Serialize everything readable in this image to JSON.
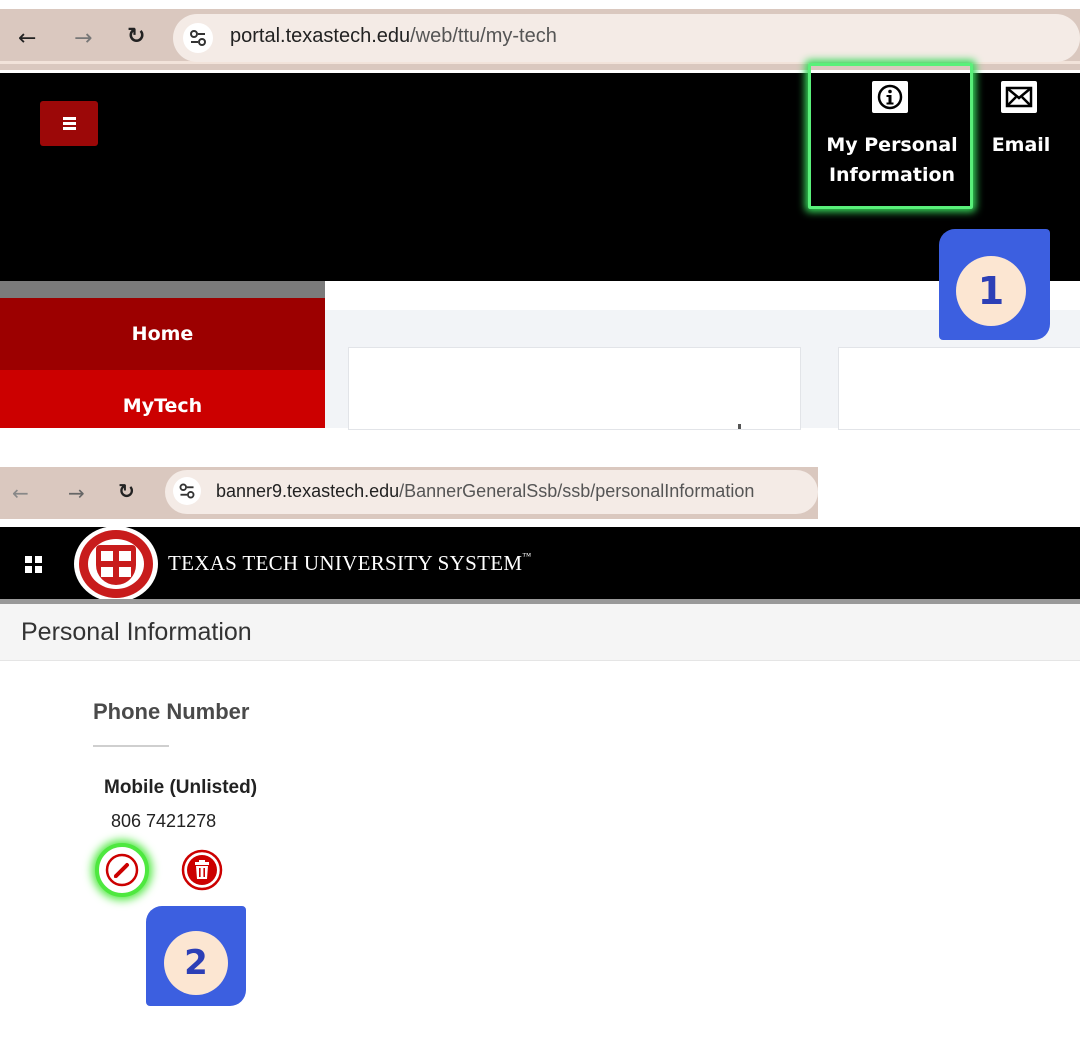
{
  "top_screenshot": {
    "browser": {
      "url_host": "portal.texastech.edu",
      "url_path": "/web/ttu/my-tech"
    },
    "header": {
      "personal_info_label_line1": "My Personal",
      "personal_info_label_line2": "Information",
      "email_label": "Email"
    },
    "sidebar": {
      "items": [
        {
          "label": "Home"
        },
        {
          "label": "MyTech"
        }
      ]
    },
    "step_badge": "1"
  },
  "bottom_screenshot": {
    "browser": {
      "url_host": "banner9.texastech.edu",
      "url_path": "/BannerGeneralSsb/ssb/personalInformation"
    },
    "header": {
      "system_name": "TEXAS TECH UNIVERSITY SYSTEM",
      "trademark": "™"
    },
    "page_title": "Personal Information",
    "section": {
      "heading": "Phone Number",
      "phone_type": "Mobile (Unlisted)",
      "phone_number": "806 7421278"
    },
    "step_badge": "2"
  },
  "colors": {
    "highlight_green": "#4ee83f",
    "ttu_red": "#cc0000",
    "badge_blue": "#3c5fe0",
    "badge_fill": "#fce6d2"
  },
  "icons": [
    "back-arrow-icon",
    "forward-arrow-icon",
    "reload-icon",
    "site-settings-icon",
    "hamburger-menu-icon",
    "info-icon",
    "mail-icon",
    "apps-grid-icon",
    "university-seal-icon",
    "pencil-icon",
    "trash-icon"
  ]
}
